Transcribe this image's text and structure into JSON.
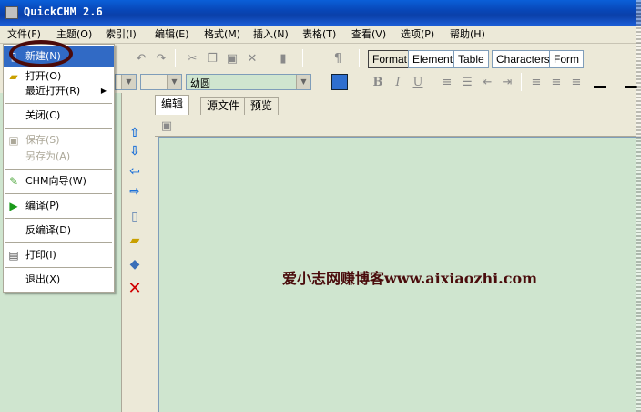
{
  "window": {
    "title": "QuickCHM 2.6"
  },
  "menubar": {
    "items": [
      "文件(F)",
      "主题(O)",
      "索引(I)",
      "编辑(E)",
      "格式(M)",
      "插入(N)",
      "表格(T)",
      "查看(V)",
      "选项(P)",
      "帮助(H)"
    ]
  },
  "file_menu": {
    "new": "新建(N)",
    "open": "打开(O)",
    "recent": "最近打开(R)",
    "close": "关闭(C)",
    "save": "保存(S)",
    "save_as": "另存为(A)",
    "chm_wizard": "CHM向导(W)",
    "compile": "编译(P)",
    "decompile": "反编译(D)",
    "print": "打印(I)",
    "exit": "退出(X)"
  },
  "toolbar": {
    "tabs": [
      "Format",
      "Element",
      "Table",
      "Characters",
      "Form"
    ],
    "font_name": "幼圆",
    "bold": "B",
    "italic": "I",
    "underline": "U"
  },
  "editor": {
    "tabs": [
      "编辑",
      "源文件",
      "预览"
    ],
    "watermark_text": "爱小志网赚博客www.aixiaozhi.com"
  },
  "colors": {
    "accent": "#316ac5",
    "editor_bg": "#cfe5cf",
    "annotation": "#4b0a0a"
  },
  "icons": {
    "up": "arrow-up-icon",
    "down": "arrow-down-icon",
    "left": "arrow-left-icon",
    "right": "arrow-right-icon",
    "new": "new-page-icon",
    "open": "open-folder-icon",
    "book": "book-icon",
    "delete": "delete-icon"
  }
}
